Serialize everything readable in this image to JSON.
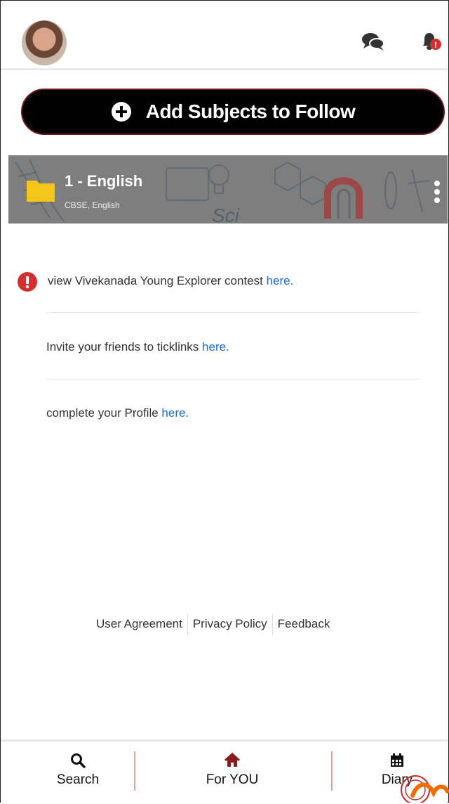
{
  "header": {
    "avatar": "user-avatar",
    "chat_icon": "chat-icon",
    "bell_icon": "bell-icon",
    "bell_badge": "!"
  },
  "add_button": {
    "label": "Add Subjects to Follow",
    "icon": "plus-circle-icon"
  },
  "subject": {
    "title": "1 - English",
    "subtitle": "CBSE, English",
    "icon": "folder-icon",
    "folder_color": "#f5c518"
  },
  "notices": [
    {
      "text": "view Vivekanada Young Explorer contest ",
      "link": "here."
    },
    {
      "text": "Invite your friends to ticklinks ",
      "link": "here."
    },
    {
      "text": "complete your Profile ",
      "link": "here."
    }
  ],
  "footer": {
    "user_agreement": "User Agreement",
    "privacy_policy": "Privacy Policy",
    "feedback": "Feedback"
  },
  "bottom_nav": [
    {
      "label": "Search",
      "icon": "search-icon"
    },
    {
      "label": "For YOU",
      "icon": "home-icon",
      "color": "#8b1a1a"
    },
    {
      "label": "Diary",
      "icon": "calendar-icon"
    }
  ],
  "colors": {
    "link": "#1a6fd6",
    "alert": "#d32f2f",
    "accent": "#8b1a1a"
  }
}
